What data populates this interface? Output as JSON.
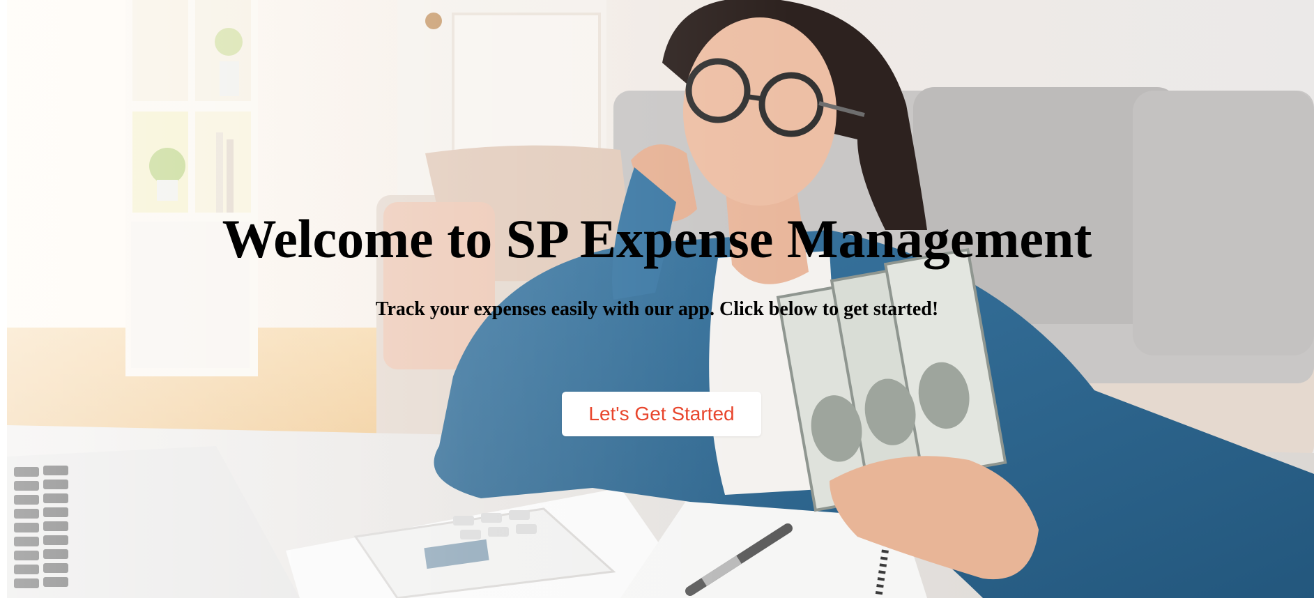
{
  "hero": {
    "title": "Welcome to SP Expense Management",
    "subtitle": "Track your expenses easily with our app. Click below to get started!",
    "cta_label": "Let's Get Started",
    "accent_color": "#e8452c",
    "background_image": "woman-holding-cash-calculator-photo"
  }
}
